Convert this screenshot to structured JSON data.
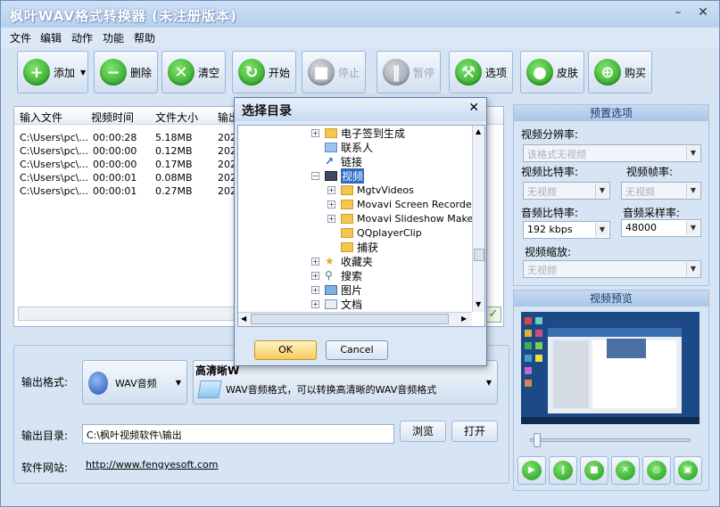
{
  "app": {
    "title": "枫叶WAV格式转换器  (未注册版本)"
  },
  "menu": [
    "文件",
    "编辑",
    "动作",
    "功能",
    "帮助"
  ],
  "toolbar": {
    "add": "添加",
    "delete": "删除",
    "clear": "清空",
    "start": "开始",
    "stop": "停止",
    "pause": "暂停",
    "options": "选项",
    "skin": "皮肤",
    "buy": "购买"
  },
  "files": {
    "columns": [
      "输入文件",
      "视频时间",
      "文件大小",
      "输出"
    ],
    "rows": [
      [
        "C:\\Users\\pc\\...",
        "00:00:28",
        "5.18MB",
        "202"
      ],
      [
        "C:\\Users\\pc\\...",
        "00:00:00",
        "0.12MB",
        "202"
      ],
      [
        "C:\\Users\\pc\\...",
        "00:00:00",
        "0.17MB",
        "202"
      ],
      [
        "C:\\Users\\pc\\...",
        "00:00:01",
        "0.08MB",
        "202"
      ],
      [
        "C:\\Users\\pc\\...",
        "00:00:01",
        "0.27MB",
        "202"
      ]
    ]
  },
  "output": {
    "format_label": "输出格式:",
    "format_value": "WAV音频",
    "quality_title": "高清晰W",
    "format_desc": "WAV音频格式，可以转换高清晰的WAV音频格式",
    "dir_label": "输出目录:",
    "dir_value": "C:\\枫叶视频软件\\输出",
    "browse": "浏览",
    "open": "打开",
    "site_label": "软件网站:",
    "site_url": "http://www.fengyesoft.com"
  },
  "preset": {
    "title": "预置选项",
    "video_resolution_label": "视频分辨率:",
    "video_resolution_value": "该格式无视频",
    "video_bitrate_label": "视频比特率:",
    "video_bitrate_value": "无视频",
    "video_fps_label": "视频帧率:",
    "video_fps_value": "无视频",
    "audio_bitrate_label": "音频比特率:",
    "audio_bitrate_value": "192 kbps",
    "audio_samplerate_label": "音频采样率:",
    "audio_samplerate_value": "48000",
    "video_scale_label": "视频缩放:",
    "video_scale_value": "无视频"
  },
  "preview": {
    "title": "视频预览"
  },
  "dialog": {
    "title": "选择目录",
    "items": [
      {
        "label": "电子签到生成",
        "level": 0,
        "expander": "+",
        "icon": "folder"
      },
      {
        "label": "联系人",
        "level": 0,
        "expander": "",
        "icon": "contacts"
      },
      {
        "label": "链接",
        "level": 0,
        "expander": "",
        "icon": "link"
      },
      {
        "label": "视频",
        "level": 0,
        "expander": "-",
        "icon": "video",
        "selected": true
      },
      {
        "label": "MgtvVideos",
        "level": 1,
        "expander": "+",
        "icon": "folder"
      },
      {
        "label": "Movavi Screen Recorder",
        "level": 1,
        "expander": "+",
        "icon": "folder"
      },
      {
        "label": "Movavi Slideshow Maker",
        "level": 1,
        "expander": "+",
        "icon": "folder"
      },
      {
        "label": "QQplayerClip",
        "level": 1,
        "expander": "",
        "icon": "folder"
      },
      {
        "label": "捕获",
        "level": 1,
        "expander": "",
        "icon": "folder"
      },
      {
        "label": "收藏夹",
        "level": 0,
        "expander": "+",
        "icon": "star"
      },
      {
        "label": "搜索",
        "level": 0,
        "expander": "+",
        "icon": "search"
      },
      {
        "label": "图片",
        "level": 0,
        "expander": "+",
        "icon": "pictures"
      },
      {
        "label": "文档",
        "level": 0,
        "expander": "+",
        "icon": "documents"
      }
    ],
    "ok": "OK",
    "cancel": "Cancel"
  }
}
